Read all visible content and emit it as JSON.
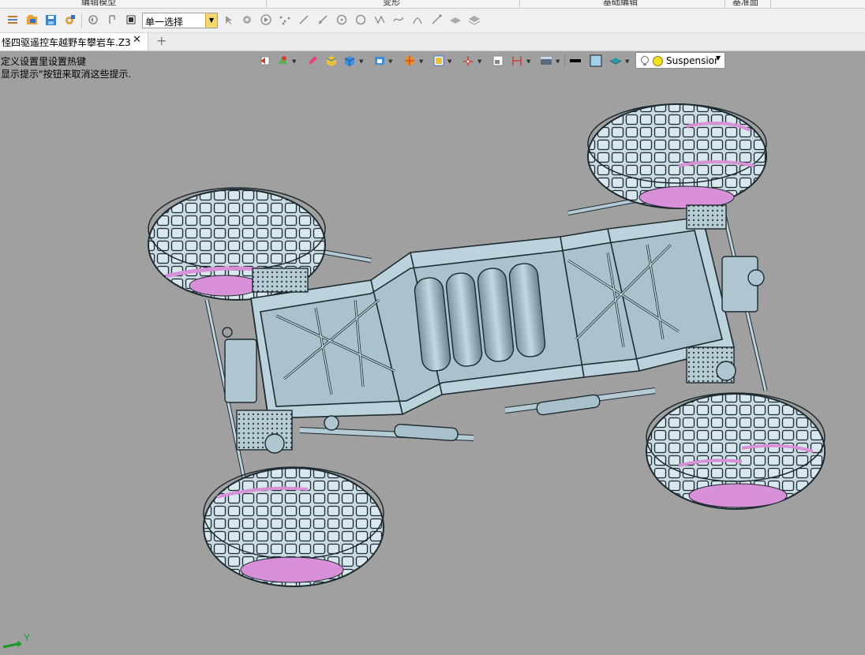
{
  "top_tabs": [
    "编辑模型",
    "变形",
    "基础编辑",
    "基准面"
  ],
  "toolbar": {
    "selection_mode": "单一选择"
  },
  "document_tab": {
    "title": "​怪四驱遥控车越野车攀岩车.Z3",
    "close_symbol": "✕",
    "add_symbol": "+"
  },
  "hints": [
    "定义设置里设置热键",
    "显示提示\"按钮来取消这些提示."
  ],
  "view_toolbar": {
    "light_setting": "Suspensior"
  },
  "axis": {
    "label": "Y"
  },
  "colors": {
    "model_fill": "#bcd2dc",
    "model_edge": "#1d2a30",
    "accent_magenta": "#d890d8",
    "viewport_bg": "#a0a0a0"
  }
}
